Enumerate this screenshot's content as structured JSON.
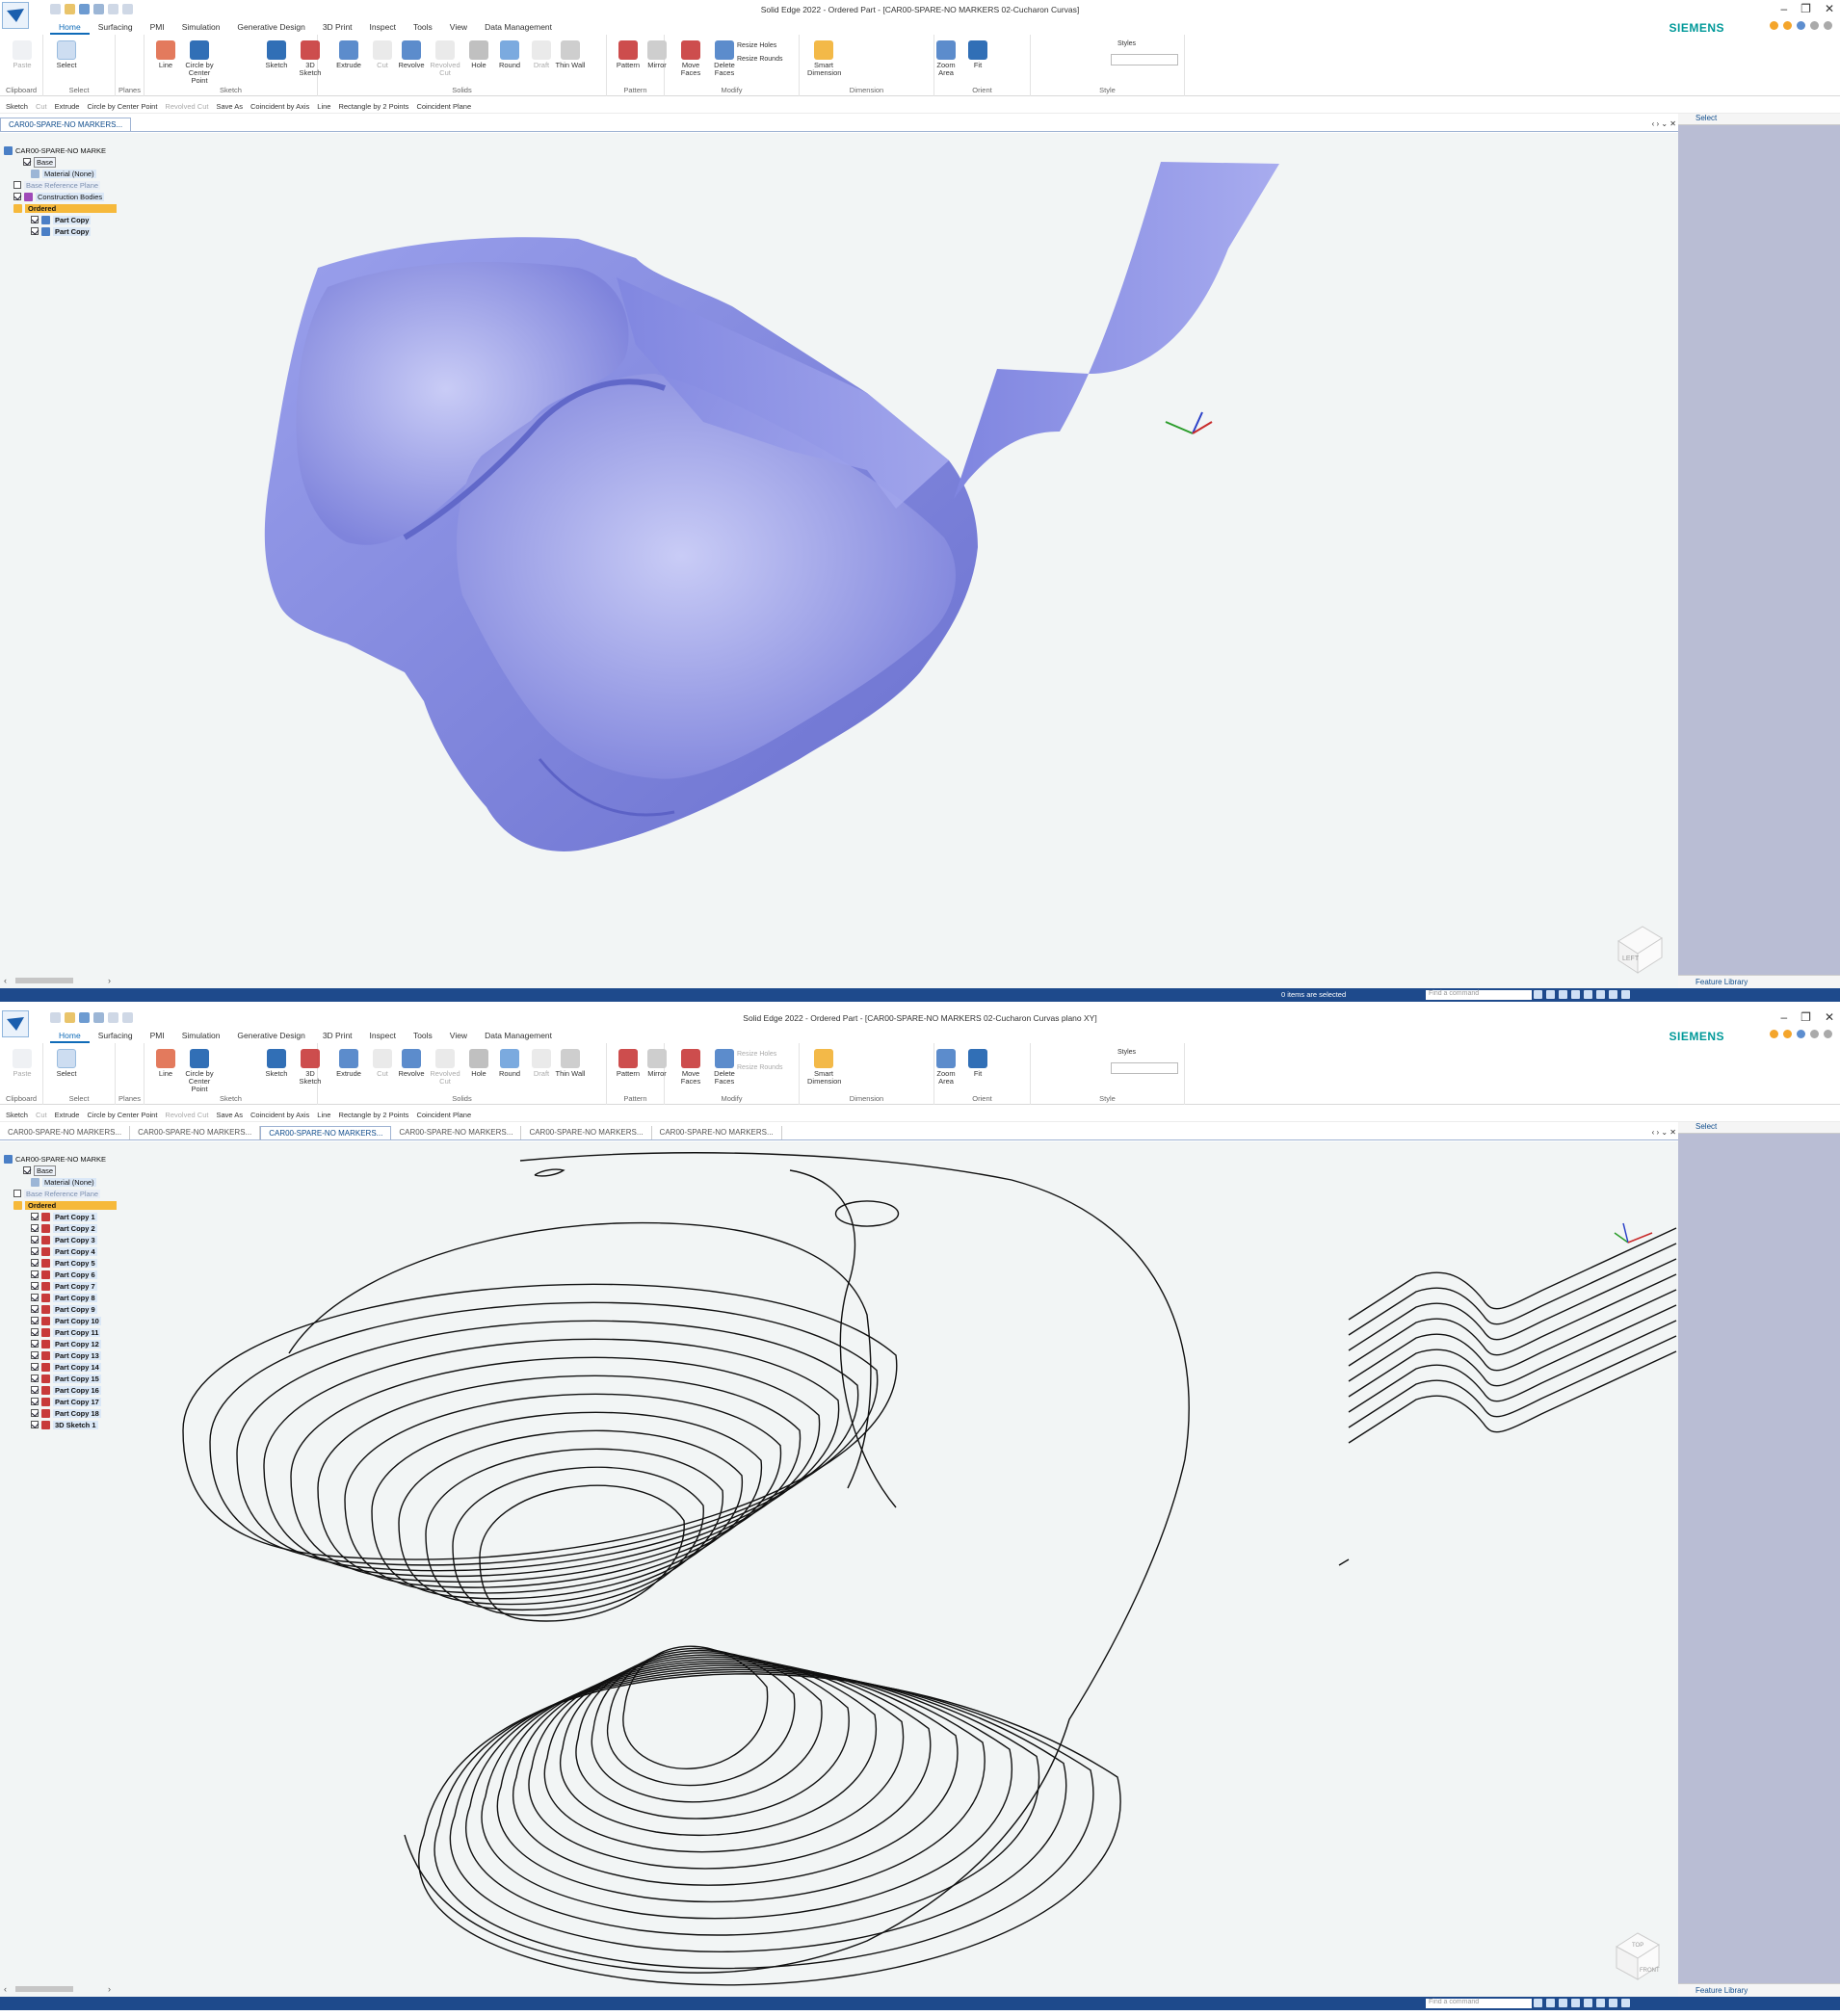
{
  "colors": {
    "accent": "#0f6bb8",
    "status": "#1e4a8c",
    "model": "#8a8fe0",
    "panel": "#b9bdd4",
    "ordered": "#f6b93b",
    "brand": "#009999"
  },
  "ribbon": {
    "tabs": [
      "Home",
      "Surfacing",
      "PMI",
      "Simulation",
      "Generative Design",
      "3D Print",
      "Inspect",
      "Tools",
      "View",
      "Data Management"
    ],
    "brand": "SIEMENS",
    "buttons": {
      "paste": "Paste",
      "select": "Select",
      "line": "Line",
      "circle": "Circle by Center Point",
      "sketch": "Sketch",
      "sketch3d": "3D Sketch",
      "extrude": "Extrude",
      "cut": "Cut",
      "revolve": "Revolve",
      "revolved_cut": "Revolved Cut",
      "hole": "Hole",
      "round": "Round",
      "draft": "Draft",
      "thin_wall": "Thin Wall",
      "pattern": "Pattern",
      "mirror": "Mirror",
      "move_faces": "Move Faces",
      "delete_faces": "Delete Faces",
      "resize_holes": "Resize Holes",
      "resize_rounds": "Resize Rounds",
      "smart_dimension": "Smart Dimension",
      "zoom_area": "Zoom Area",
      "fit": "Fit",
      "styles": "Styles"
    },
    "groups": {
      "clipboard": "Clipboard",
      "select": "Select",
      "planes": "Planes",
      "sketch": "Sketch",
      "solids": "Solids",
      "pattern": "Pattern",
      "modify": "Modify",
      "dimension": "Dimension",
      "orient": "Orient",
      "style": "Style"
    }
  },
  "command_bar": [
    "Sketch",
    "Cut",
    "Extrude",
    "Circle by Center Point",
    "Revolved Cut",
    "Save As",
    "Coincident by Axis",
    "Line",
    "Rectangle by 2 Points",
    "Coincident Plane"
  ],
  "command_bar_dim": [
    false,
    true,
    false,
    false,
    true,
    false,
    false,
    false,
    false,
    false
  ],
  "window1": {
    "title": "Solid Edge 2022 - Ordered Part - [CAR00-SPARE-NO MARKERS 02-Cucharon Curvas]",
    "doc_tabs": [
      "CAR00-SPARE-NO MARKERS..."
    ],
    "tree": {
      "root": "CAR00-SPARE-NO MARKE",
      "base": "Base",
      "material": "Material (None)",
      "ref_planes": "Base Reference Plane",
      "construction": "Construction Bodies",
      "ordered": "Ordered",
      "items": [
        "Part Copy",
        "Part Copy"
      ]
    },
    "panel_header": "Select",
    "panel_footer": "Feature Library",
    "status": "0 items are selected",
    "find_placeholder": "Find a command",
    "viewcube": "LEFT"
  },
  "window2": {
    "title": "Solid Edge 2022 - Ordered Part - [CAR00-SPARE-NO MARKERS 02-Cucharon Curvas plano XY]",
    "doc_tabs": [
      "CAR00-SPARE-NO MARKERS...",
      "CAR00-SPARE-NO MARKERS...",
      "CAR00-SPARE-NO MARKERS...",
      "CAR00-SPARE-NO MARKERS...",
      "CAR00-SPARE-NO MARKERS...",
      "CAR00-SPARE-NO MARKERS..."
    ],
    "tree": {
      "root": "CAR00-SPARE-NO MARKE",
      "base": "Base",
      "material": "Material (None)",
      "ref_planes": "Base Reference Plane",
      "ordered": "Ordered",
      "items": [
        "Part Copy 1",
        "Part Copy 2",
        "Part Copy 3",
        "Part Copy 4",
        "Part Copy 5",
        "Part Copy 6",
        "Part Copy 7",
        "Part Copy 8",
        "Part Copy 9",
        "Part Copy 10",
        "Part Copy 11",
        "Part Copy 12",
        "Part Copy 13",
        "Part Copy 14",
        "Part Copy 15",
        "Part Copy 16",
        "Part Copy 17",
        "Part Copy 18",
        "3D Sketch 1"
      ]
    },
    "panel_header": "Select",
    "panel_footer": "Feature Library",
    "find_placeholder": "Find a command",
    "viewcube_top": "TOP",
    "viewcube_front": "FRONT"
  }
}
